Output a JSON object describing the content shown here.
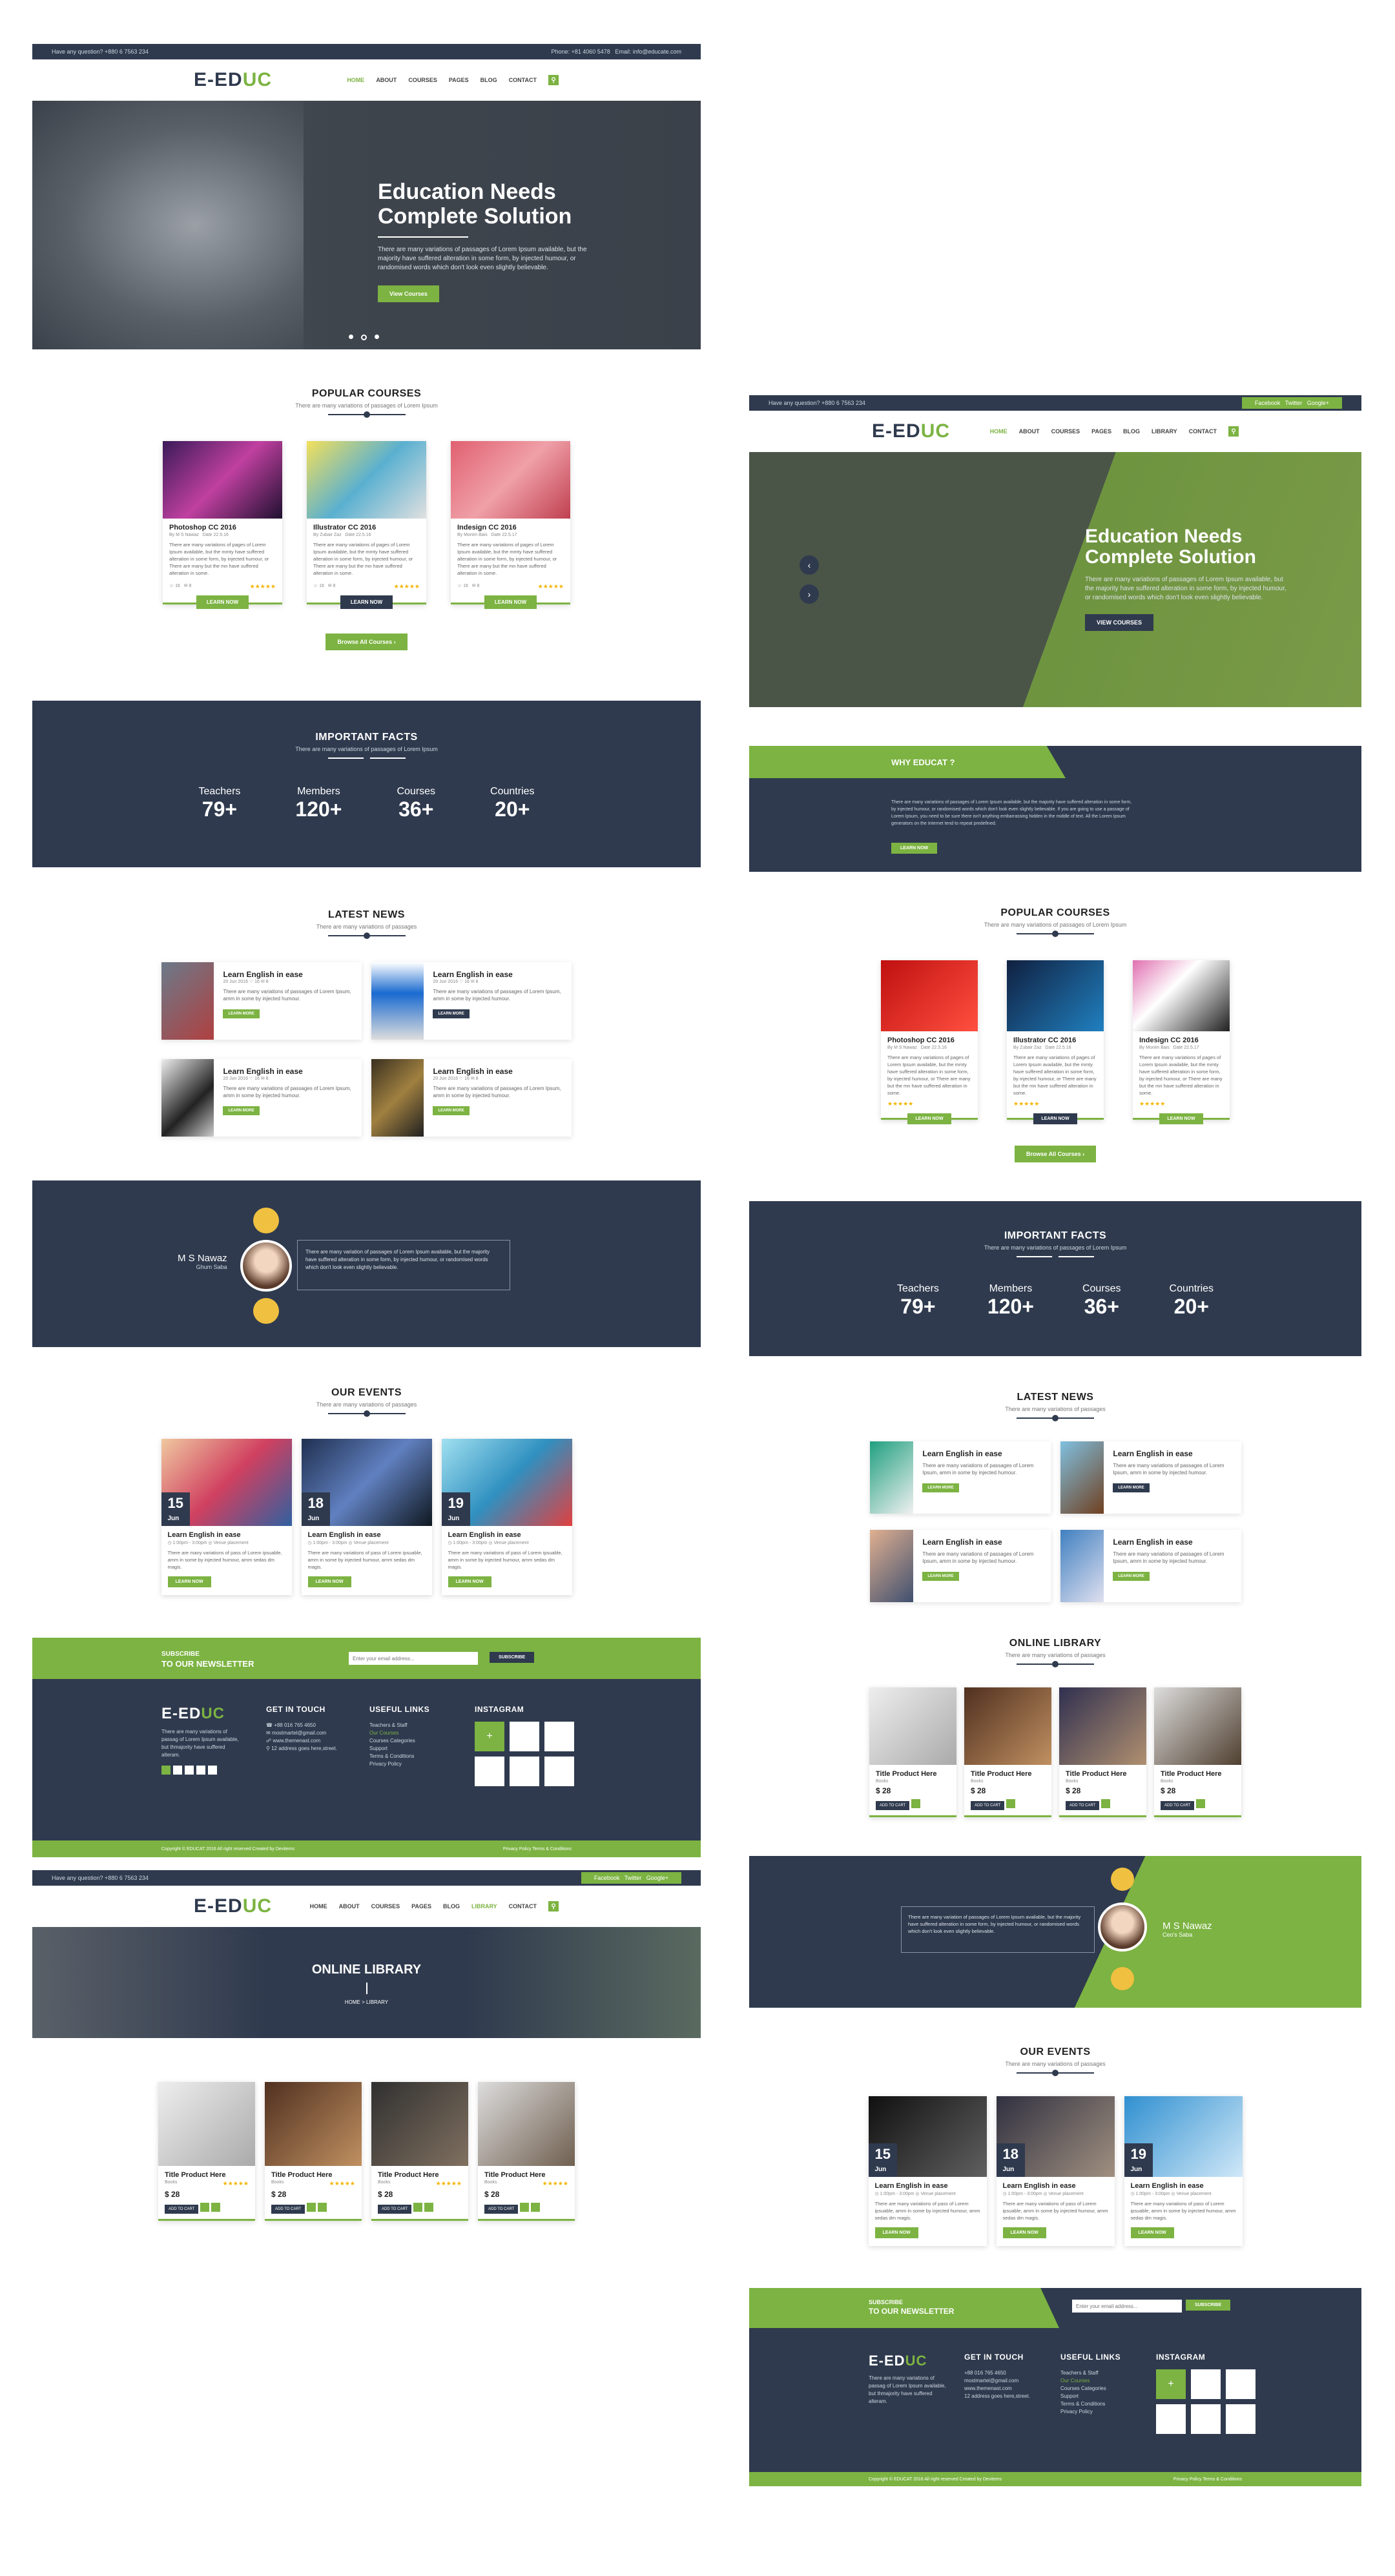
{
  "topbar": {
    "left": "Have any question? +880 6 7563 234",
    "phone": "Phone: +81 4060 5478",
    "email": "Email: info@educate.com"
  },
  "brand": {
    "logo_a": "E-ED",
    "logo_b": "UC"
  },
  "menu": [
    "HOME",
    "ABOUT",
    "COURSES",
    "PAGES",
    "BLOG",
    "CONTACT"
  ],
  "menu2": [
    "HOME",
    "ABOUT",
    "COURSES",
    "PAGES",
    "BLOG",
    "LIBRARY",
    "CONTACT"
  ],
  "hero": {
    "title1": "Education Needs",
    "title2": "Complete Solution",
    "text": "There are many variations of passages of Lorem Ipsum available, but the majority have suffered alteration in some form, by injected humour, or randomised words which don't look even slightly believable.",
    "button": "View Courses",
    "button2": "VIEW COURSES"
  },
  "popular": {
    "title": "POPULAR COURSES",
    "sub": "There are many variations of passages of Lorem Ipsum",
    "browse": "Browse All Courses",
    "courses": [
      {
        "title": "Photoshop CC 2016",
        "by": "M S Nawaz",
        "date": "22.5.16",
        "text": "There are many variations of pages of Lorem Ipsum available, but the mmty have suffered alteration in some form, by injected humour, or There are many but the mn have suffered alteration in some.",
        "btn": "LEARN NOW"
      },
      {
        "title": "Illustrator CC 2016",
        "by": "Zubair Zaz",
        "date": "22.5.16",
        "text": "There are many variations of pages of Lorem Ipsum available, but the mmty have suffered alteration in some form, by injected humour, or There are many but the mn have suffered alteration in some.",
        "btn": "LEARN NOW"
      },
      {
        "title": "Indesign CC 2016",
        "by": "Monim Bais",
        "date": "22.5.17",
        "text": "There are many variations of pages of Lorem Ipsum available, but the mmty have suffered alteration in some form, by injected humour, or There are many but the mn have suffered alteration in some.",
        "btn": "LEARN NOW"
      }
    ]
  },
  "facts": {
    "title": "IMPORTANT FACTS",
    "sub": "There are many variations of passages of Lorem Ipsum",
    "items": [
      {
        "label": "Teachers",
        "value": "79+"
      },
      {
        "label": "Members",
        "value": "120+"
      },
      {
        "label": "Courses",
        "value": "36+"
      },
      {
        "label": "Countries",
        "value": "20+"
      }
    ]
  },
  "news": {
    "title": "LATEST NEWS",
    "sub": "There are many variations of passages",
    "item_title": "Learn English in ease",
    "item_meta": "20 Jun 2016   ♡ 16   ✉ 8",
    "item_text": "There are many variations of passages of Lorem Ipsum, amm in some by injected humour.",
    "btn": "LEARN MORE"
  },
  "testimonial": {
    "name": "M S Nawaz",
    "role": "Ghum Saba",
    "role2": "Ceo's Saba",
    "quote": "There are many variation of passages of Lorem Ipsum available, but the majority have suffered alteration in some form, by injected humour, or randomised words which don't look even slightly believable."
  },
  "events": {
    "title": "OUR EVENTS",
    "sub": "There are many variations of passages",
    "items": [
      {
        "day": "15",
        "month": "Jun"
      },
      {
        "day": "18",
        "month": "Jun"
      },
      {
        "day": "19",
        "month": "Jun"
      }
    ],
    "item_title": "Learn English in ease",
    "item_meta": "◷ 1:00pm - 3:00pm   ◎ Venue placement",
    "item_text": "There are many variations of pass of Lorem ipsuable, amm in some by injected humour, amm sedas dm magis.",
    "btn": "LEARN NOW"
  },
  "newsletter": {
    "title1": "SUBSCRIBE",
    "title2": "TO OUR NEWSLETTER",
    "placeholder": "Enter your email address...",
    "btn": "SUBSCRIBE"
  },
  "footer": {
    "about": "There are many variations of passag of Lorem Ipsum available, but thmajority have suffered alteram.",
    "touch_title": "GET IN TOUCH",
    "touch": [
      "+88 016 765 4650",
      "mostmartel@gmail.com",
      "www.themenast.com",
      "12 address goes here,street."
    ],
    "links_title": "USEFUL LINKS",
    "links": [
      "Teachers & Staff",
      "Our Courses",
      "Courses Categories",
      "Support",
      "Terms & Conditions",
      "Privacy Policy"
    ],
    "insta_title": "INSTAGRAM",
    "copyright": "Copyright © EDUCAT 2016 All right reserved Created by Devitems",
    "legal": "Privacy Policy  Terms & Conditions"
  },
  "library": {
    "banner": "ONLINE LIBRARY",
    "crumb_home": "HOME",
    "crumb_sep": ">",
    "crumb_page": "LIBRARY",
    "title": "ONLINE LIBRARY",
    "sub": "There are many variations of passages",
    "item_title": "Title Product Here",
    "item_cat": "Books",
    "price": "$ 28",
    "cart": "ADD TO CART"
  },
  "why": {
    "title": "WHY EDUCAT ?",
    "text": "There are many variations of passages of Lorem Ipsum available, but the majority have suffered alteration in some form, by injected humour, or randomised words which don't look even slightly believable. If you are going to use a passage of Lorem Ipsum, you need to be sure there isn't anything embarrassing hidden in the middle of text. All the Lorem Ipsum generators on the Internet tend to repeat predefined.",
    "btn": "LEARN NOW"
  },
  "social_top": {
    "facebook": "Facebook",
    "twitter": "Twitter",
    "google": "Google+"
  },
  "colors": {
    "navy": "#2f3a4e",
    "green": "#7cb342"
  }
}
